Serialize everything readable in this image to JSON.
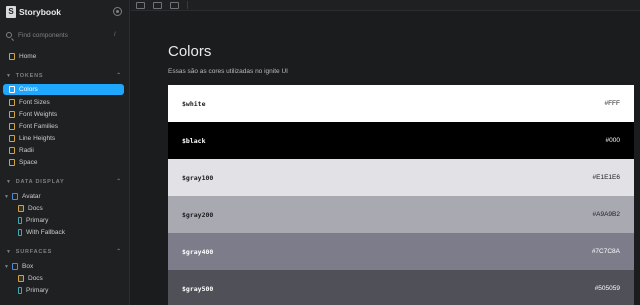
{
  "app": {
    "name": "Storybook"
  },
  "search": {
    "placeholder": "Find components",
    "shortcut": "/"
  },
  "sidebar": {
    "home": "Home",
    "sections": [
      {
        "title": "TOKENS",
        "toggle": "⌃"
      },
      {
        "title": "DATA DISPLAY",
        "toggle": "⌃"
      },
      {
        "title": "SURFACES",
        "toggle": "⌃"
      }
    ],
    "tokens": [
      "Colors",
      "Font Sizes",
      "Font Weights",
      "Font Families",
      "Line Heights",
      "Radii",
      "Space"
    ],
    "data_display": {
      "component": "Avatar",
      "stories": [
        "Docs",
        "Primary",
        "With Fallback"
      ]
    },
    "surfaces": {
      "component": "Box",
      "stories": [
        "Docs",
        "Primary"
      ]
    }
  },
  "main": {
    "title": "Colors",
    "subtitle": "Essas são as cores utilizadas no ignite UI",
    "colors": [
      {
        "name": "$white",
        "hex": "#FFF",
        "bg": "#ffffff",
        "fg": "#1b1c1d"
      },
      {
        "name": "$black",
        "hex": "#000",
        "bg": "#000000",
        "fg": "#ffffff"
      },
      {
        "name": "$gray100",
        "hex": "#E1E1E6",
        "bg": "#e1e1e6",
        "fg": "#1b1c1d"
      },
      {
        "name": "$gray200",
        "hex": "#A9A9B2",
        "bg": "#a9a9b2",
        "fg": "#1b1c1d"
      },
      {
        "name": "$gray400",
        "hex": "#7C7C8A",
        "bg": "#7c7c8a",
        "fg": "#ffffff"
      },
      {
        "name": "$gray500",
        "hex": "#505059",
        "bg": "#505059",
        "fg": "#ffffff"
      }
    ]
  },
  "colors": {
    "accent": "#1ea7fd"
  }
}
